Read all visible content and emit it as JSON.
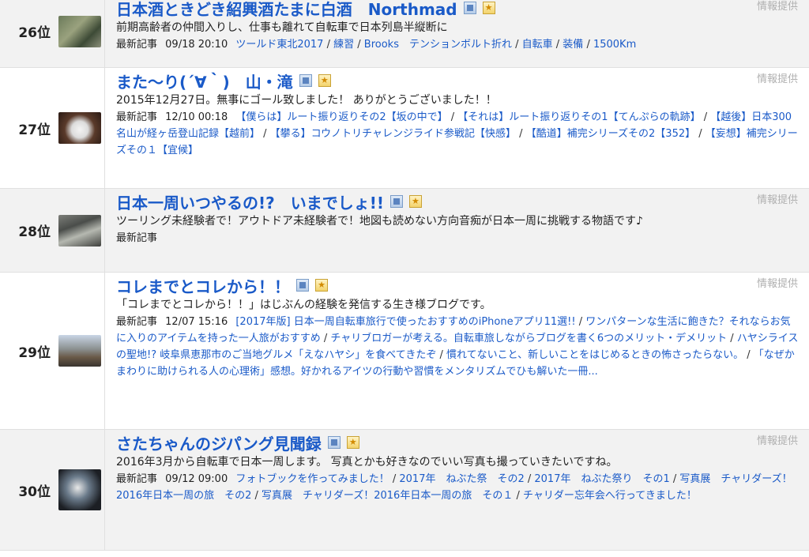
{
  "rows": [
    {
      "rank": "26位",
      "title": "日本酒ときどき紹興酒たまに白酒　Northmad",
      "provider": "情報提供",
      "desc": "前期高齢者の仲間入りし、仕事も離れて自転車で日本列島半縦断に",
      "latest_label": "最新記事",
      "date": "09/18 20:10",
      "posts": [
        "ツールド東北2017",
        "練習",
        "Brooks　テンションボルト折れ",
        "自転車",
        "装備",
        "1500Km"
      ]
    },
    {
      "rank": "27位",
      "title": "また～り(´∀｀)　山・滝",
      "provider": "情報提供",
      "desc": "2015年12月27日。無事にゴール致しました！ ありがとうございました！！",
      "latest_label": "最新記事",
      "date": "12/10 00:18",
      "posts": [
        "【僕らは】ルート振り返りその2【坂の中で】",
        "【それは】ルート振り返りその1【てんぷらの軌跡】",
        "【越後】日本300名山が経ヶ岳登山記録【越前】",
        "【攀る】コウノトリチャレンジライド参戦記【快感】",
        "【酷道】補完シリーズその2【352】",
        "【妄想】補完シリーズその１【宜候】"
      ]
    },
    {
      "rank": "28位",
      "title": "日本一周いつやるの!?　いまでしょ!!",
      "provider": "情報提供",
      "desc": "ツーリング未経験者で！アウトドア未経験者で！地図も読めない方向音痴が日本一周に挑戦する物語です♪",
      "latest_label": "最新記事",
      "date": "",
      "posts": []
    },
    {
      "rank": "29位",
      "title": "コレまでとコレから！！",
      "provider": "情報提供",
      "desc": "「コレまでとコレから！！」はじぶんの経験を発信する生き様ブログです。",
      "latest_label": "最新記事",
      "date": "12/07 15:16",
      "posts": [
        "[2017年版] 日本一周自転車旅行で使ったおすすめのiPhoneアプリ11選!!",
        "ワンパターンな生活に飽きた？それならお気に入りのアイテムを持った一人旅がおすすめ",
        "チャリブロガーが考える。自転車旅しながらブログを書く6つのメリット・デメリット",
        "ハヤシライスの聖地!? 岐阜県恵那市のご当地グルメ「えなハヤシ」を食べてきたぞ",
        "慣れてないこと、新しいことをはじめるときの怖さったらない。",
        "「なぜかまわりに助けられる人の心理術」感想。好かれるアイツの行動や習慣をメンタリズムでひも解いた一冊..."
      ]
    },
    {
      "rank": "30位",
      "title": "さたちゃんのジパング見聞録",
      "provider": "情報提供",
      "desc": "2016年3月から自転車で日本一周します。 写真とかも好きなのでいい写真も撮っていきたいですね。",
      "latest_label": "最新記事",
      "date": "09/12 09:00",
      "posts": [
        "フォトブックを作ってみました！",
        "2017年　ねぶた祭　その2",
        "2017年　ねぶた祭り　その1",
        "写真展　チャリダーズ！2016年日本一周の旅　その2",
        "写真展　チャリダーズ！2016年日本一周の旅　その１",
        "チャリダー忘年会へ行ってきました！"
      ]
    }
  ],
  "colors": {
    "link": "#1a5ac8",
    "alt_row": "#f2f2f2",
    "provider": "#b0b0b0"
  },
  "icons": {
    "feed": "feed-icon",
    "favorite": "favorite-icon"
  }
}
